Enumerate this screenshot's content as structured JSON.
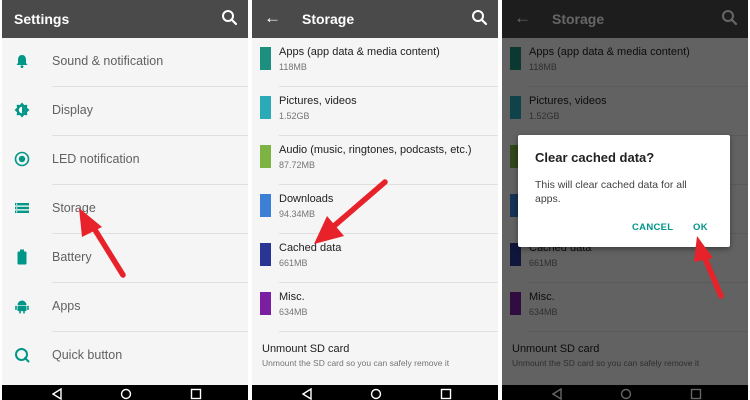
{
  "settings": {
    "title": "Settings",
    "items": [
      {
        "label": "Sound & notification",
        "icon": "bell-icon"
      },
      {
        "label": "Display",
        "icon": "brightness-icon"
      },
      {
        "label": "LED notification",
        "icon": "led-icon"
      },
      {
        "label": "Storage",
        "icon": "storage-icon"
      },
      {
        "label": "Battery",
        "icon": "battery-icon"
      },
      {
        "label": "Apps",
        "icon": "android-icon"
      },
      {
        "label": "Quick button",
        "icon": "quick-button-icon"
      }
    ]
  },
  "storage": {
    "title": "Storage",
    "items": [
      {
        "label": "Apps (app data & media content)",
        "size": "118MB",
        "color": "#1c8f7e"
      },
      {
        "label": "Pictures, videos",
        "size": "1.52GB",
        "color": "#2aa9b7"
      },
      {
        "label": "Audio (music, ringtones, podcasts, etc.)",
        "size": "87.72MB",
        "color": "#7cb342"
      },
      {
        "label": "Downloads",
        "size": "94.34MB",
        "color": "#3b7fd6"
      },
      {
        "label": "Cached data",
        "size": "661MB",
        "color": "#283593"
      },
      {
        "label": "Misc.",
        "size": "634MB",
        "color": "#7b1fa2"
      }
    ],
    "unmount": {
      "label": "Unmount SD card",
      "sub": "Unmount the SD card so you can safely remove it"
    }
  },
  "dialog": {
    "title": "Clear cached data?",
    "message": "This will clear cached data for all apps.",
    "cancel": "CANCEL",
    "ok": "OK"
  },
  "colors": {
    "appbar": "#4a4a4a",
    "icon_teal": "#009688",
    "arrow_red": "#e8222a"
  }
}
